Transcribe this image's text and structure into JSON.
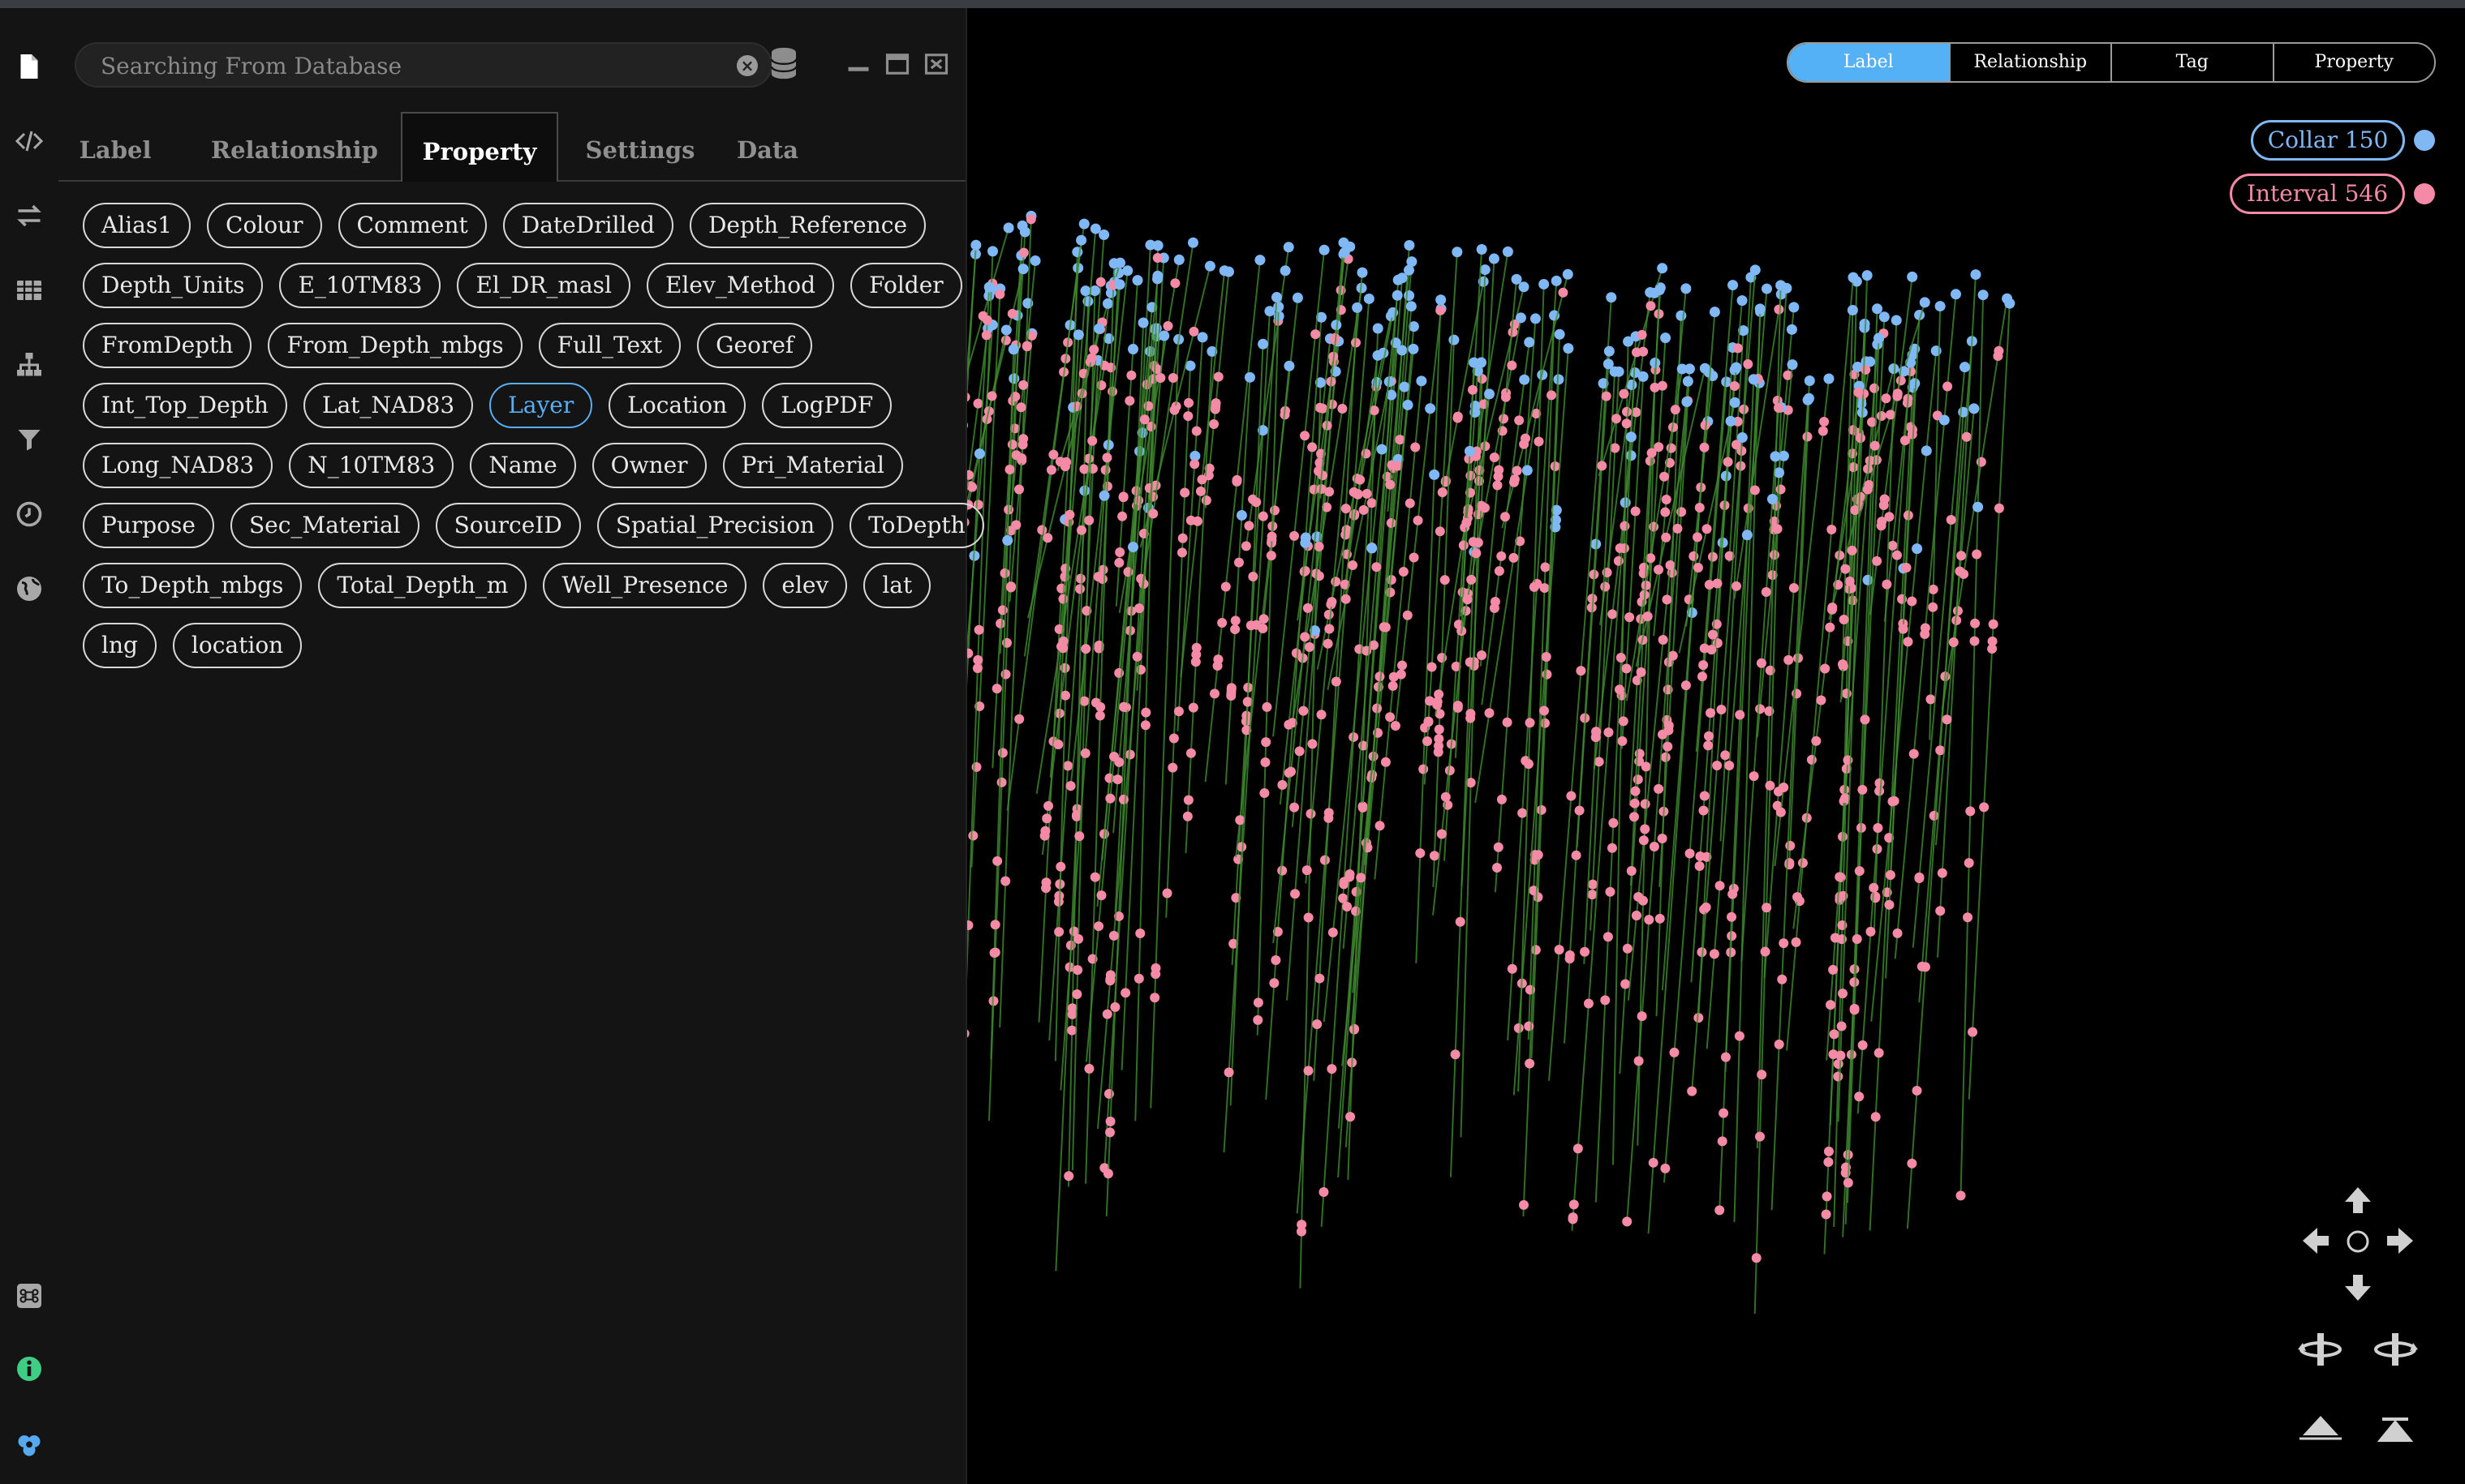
{
  "search": {
    "placeholder": "Searching From Database"
  },
  "tabs": [
    "Label",
    "Relationship",
    "Property",
    "Settings",
    "Data"
  ],
  "active_tab": "Property",
  "properties": [
    [
      "Alias1",
      "Colour",
      "Comment",
      "DateDrilled",
      "Depth_Reference"
    ],
    [
      "Depth_Units",
      "E_10TM83",
      "El_DR_masl",
      "Elev_Method",
      "Folder"
    ],
    [
      "FromDepth",
      "From_Depth_mbgs",
      "Full_Text",
      "Georef"
    ],
    [
      "Int_Top_Depth",
      "Lat_NAD83",
      "Layer",
      "Location",
      "LogPDF"
    ],
    [
      "Long_NAD83",
      "N_10TM83",
      "Name",
      "Owner",
      "Pri_Material"
    ],
    [
      "Purpose",
      "Sec_Material",
      "SourceID",
      "Spatial_Precision",
      "ToDepth"
    ],
    [
      "To_Depth_mbgs",
      "Total_Depth_m",
      "Well_Presence",
      "elev",
      "lat"
    ],
    [
      "lng",
      "location"
    ]
  ],
  "active_property": "Layer",
  "view_modes": [
    "Label",
    "Relationship",
    "Tag",
    "Property"
  ],
  "active_view_mode": "Label",
  "legend": [
    {
      "label": "Collar 150",
      "color": "#7fb8f5"
    },
    {
      "label": "Interval 546",
      "color": "#f58aa6"
    }
  ],
  "colors": {
    "accent": "#55b1f6",
    "collar": "#7fb8f5",
    "interval": "#f58aa6",
    "edge": "#3f8a2e"
  },
  "rail_icons": [
    "file-icon",
    "code-icon",
    "swap-icon",
    "table-icon",
    "hierarchy-icon",
    "filter-icon",
    "history-icon",
    "globe-icon",
    "command-icon",
    "info-icon",
    "community-icon"
  ]
}
